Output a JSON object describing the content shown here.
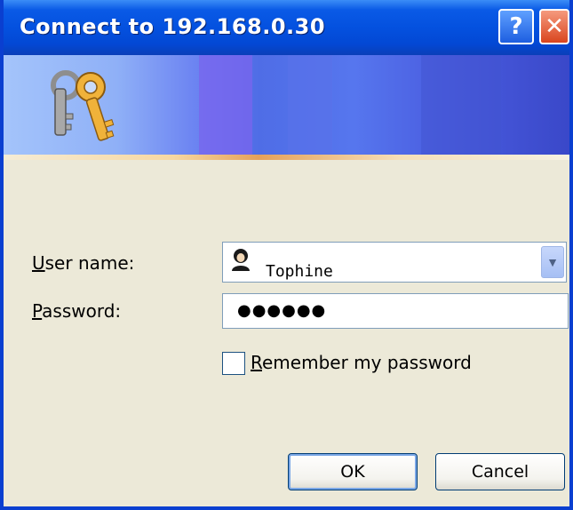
{
  "window": {
    "title": "Connect to 192.168.0.30",
    "help_glyph": "?",
    "close_glyph": "✕"
  },
  "form": {
    "username_label_accel": "U",
    "username_label_rest": "ser name:",
    "username_value": "Tophine",
    "username_icon": "user-icon",
    "password_label_accel": "P",
    "password_label_rest": "assword:",
    "password_mask": "●●●●●●",
    "remember_label_accel": "R",
    "remember_label_rest": "emember my password",
    "remember_checked": false
  },
  "buttons": {
    "ok_label": "OK",
    "cancel_label": "Cancel"
  },
  "colors": {
    "titlebar": "#0451df",
    "dialog_bg": "#ece9d8",
    "button_border": "#003c74"
  }
}
